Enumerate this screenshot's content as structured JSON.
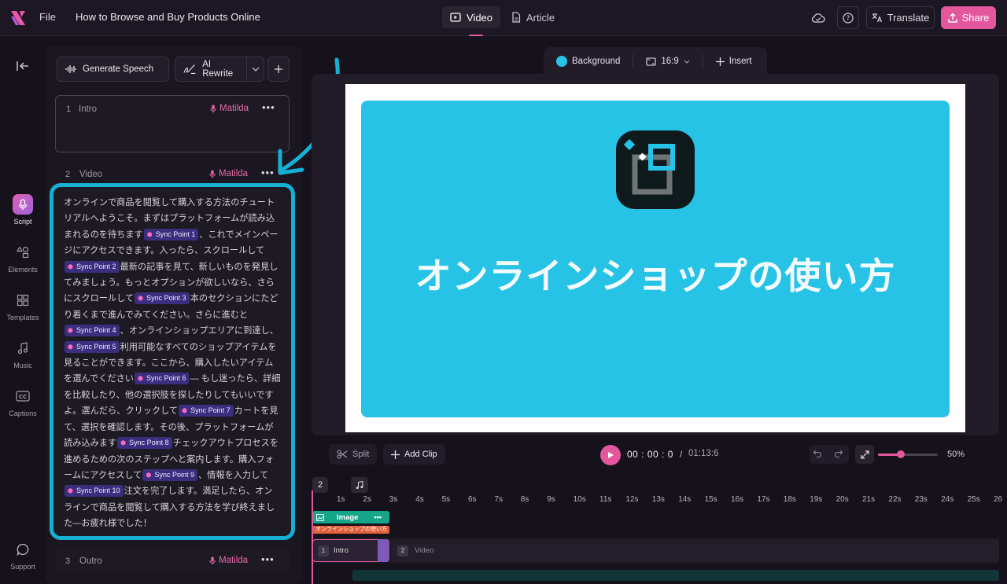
{
  "topbar": {
    "file_label": "File",
    "doc_title": "How to Browse and Buy Products Online",
    "tabs": [
      {
        "label": "Video",
        "active": true
      },
      {
        "label": "Article",
        "active": false
      }
    ],
    "translate_label": "Translate",
    "share_label": "Share",
    "accent_color": "#e4579d"
  },
  "rail": {
    "items": [
      {
        "label": "Script",
        "icon": "mic-icon",
        "active": true
      },
      {
        "label": "Elements",
        "icon": "shapes-icon"
      },
      {
        "label": "Templates",
        "icon": "grid-icon"
      },
      {
        "label": "Music",
        "icon": "music-icon"
      },
      {
        "label": "Captions",
        "icon": "cc-icon"
      },
      {
        "label": "Support",
        "icon": "chat-icon"
      }
    ]
  },
  "script_panel": {
    "generate_speech": "Generate Speech",
    "ai_rewrite": "AI Rewrite",
    "scenes": [
      {
        "num": "1",
        "name": "Intro",
        "voice": "Matilda"
      },
      {
        "num": "2",
        "name": "Video",
        "voice": "Matilda"
      },
      {
        "num": "3",
        "name": "Outro",
        "voice": "Matilda"
      }
    ],
    "script_segments": [
      {
        "text": "オンラインで商品を閲覧して購入する方法のチュートリアルへようこそ。まずはプラットフォームが読み込まれるのを待ちます"
      },
      {
        "sync": "Sync Point 1"
      },
      {
        "text": "、これでメインページにアクセスできます。入ったら、スクロールして"
      },
      {
        "sync": "Sync Point 2"
      },
      {
        "text": "最新の記事を見て、新しいものを発見してみましょう。もっとオプションが欲しいなら、さらにスクロールして"
      },
      {
        "sync": "Sync Point 3"
      },
      {
        "text": "本のセクションにたどり着くまで進んでみてください。さらに進むと"
      },
      {
        "sync": "Sync Point 4"
      },
      {
        "text": "、オンラインショップエリアに到達し、"
      },
      {
        "sync": "Sync Point 5"
      },
      {
        "text": "利用可能なすべてのショップアイテムを見ることができます。ここから、購入したいアイテムを選んでください"
      },
      {
        "sync": "Sync Point 6"
      },
      {
        "text": "— もし迷ったら、詳細を比較したり、他の選択肢を探したりしてもいいですよ。選んだら、クリックして"
      },
      {
        "sync": "Sync Point 7"
      },
      {
        "text": "カートを見て、選択を確認します。その後、プラットフォームが読み込みます"
      },
      {
        "sync": "Sync Point 8"
      },
      {
        "text": "チェックアウトプロセスを進めるための次のステップへと案内します。購入フォームにアクセスして"
      },
      {
        "sync": "Sync Point 9"
      },
      {
        "text": "、情報を入力して"
      },
      {
        "sync": "Sync Point 10"
      },
      {
        "text": "注文を完了します。満足したら、オンラインで商品を閲覧して購入する方法を学び終えました—お疲れ様でした！"
      }
    ]
  },
  "canvas": {
    "toolbar": {
      "background": "Background",
      "aspect": "16:9",
      "insert": "Insert"
    },
    "slide_title": "オンラインショップの使い方",
    "slide_color": "#26c3e6"
  },
  "playback": {
    "split": "Split",
    "add_clip": "Add Clip",
    "current_time": "00 : 00 : 0",
    "separator": "/",
    "total_time": "01:13:6",
    "zoom_percent": "50%",
    "zoom_value": 0.5
  },
  "timeline": {
    "scene_badge": "2",
    "ticks": [
      "1s",
      "2s",
      "3s",
      "4s",
      "5s",
      "6s",
      "7s",
      "8s",
      "9s",
      "10s",
      "11s",
      "12s",
      "13s",
      "14s",
      "15s",
      "16s",
      "17s",
      "18s",
      "19s",
      "20s",
      "21s",
      "22s",
      "23s",
      "24s",
      "25s",
      "26"
    ],
    "clips": {
      "image_label": "Image",
      "text_label": "オンラインショップの使い方",
      "intro_num": "1",
      "intro_label": "Intro",
      "video_num": "2",
      "video_label": "Video"
    }
  }
}
